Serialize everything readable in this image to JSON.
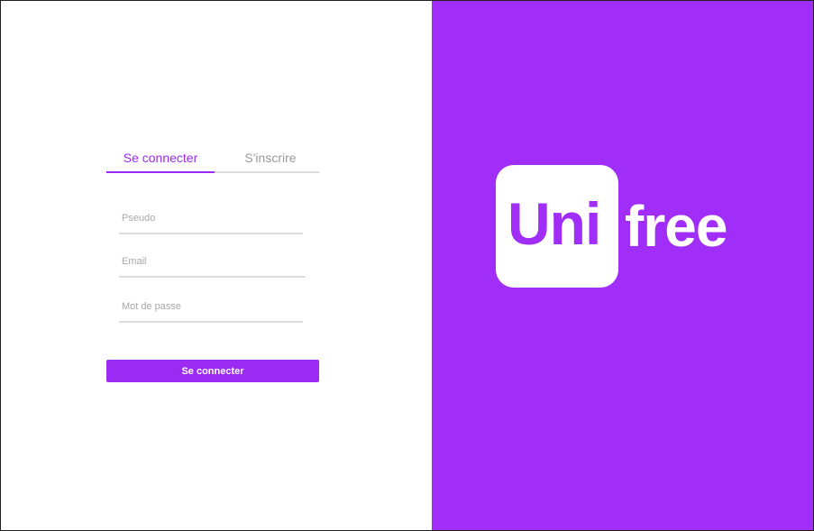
{
  "tabs": {
    "login_label": "Se connecter",
    "signup_label": "S'inscrire"
  },
  "form": {
    "pseudo_placeholder": "Pseudo",
    "pseudo_value": "",
    "email_placeholder": "Email",
    "email_value": "",
    "password_placeholder": "Mot de passe",
    "password_value": "",
    "submit_label": "Se connecter"
  },
  "logo": {
    "part1": "Uni",
    "part2": "free"
  },
  "colors": {
    "brand": "#a02ef8",
    "accent": "#9b2bf3",
    "inactive_tab": "#9a9a9a"
  }
}
